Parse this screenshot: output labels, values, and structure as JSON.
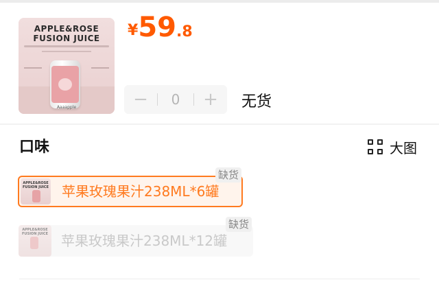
{
  "product": {
    "image_line1": "APPLE&ROSE",
    "image_line2": "FUSION JUICE",
    "image_brand": "Aaaapple"
  },
  "price": {
    "currency": "¥",
    "integer": "59",
    "decimal": ".8",
    "color": "#ff5a00"
  },
  "quantity": {
    "minus_icon": "−",
    "value": "0",
    "plus_icon": "+"
  },
  "stock_status": "无货",
  "flavor_section": {
    "title": "口味",
    "view_toggle_label": "大图",
    "view_toggle_icon": "grid-icon",
    "options": [
      {
        "label": "苹果玫瑰果汁238ML*6罐",
        "badge": "缺货",
        "selected": true,
        "thumb_line1": "APPLE&ROSE",
        "thumb_line2": "FUSION JUICE"
      },
      {
        "label": "苹果玫瑰果汁238ML*12罐",
        "badge": "缺货",
        "selected": false,
        "thumb_line1": "APPLE&ROSE",
        "thumb_line2": "FUSION JUICE"
      }
    ]
  },
  "colors": {
    "accent": "#ff7a1f",
    "selected_bg": "#fff4ec"
  }
}
